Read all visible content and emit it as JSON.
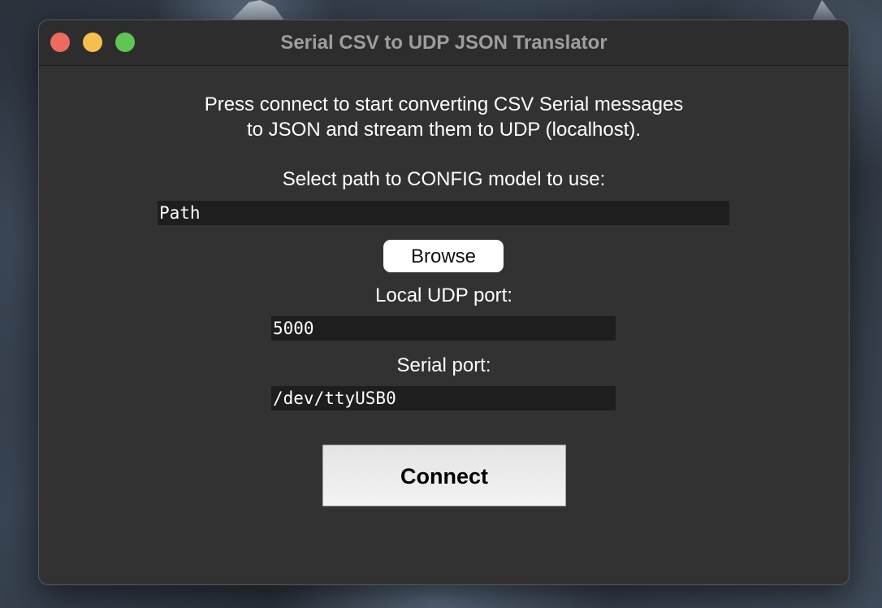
{
  "window": {
    "title": "Serial CSV to UDP JSON Translator"
  },
  "intro": {
    "line1": "Press connect to start converting CSV Serial messages",
    "line2": "to JSON and stream them to UDP (localhost)."
  },
  "config": {
    "label": "Select path to CONFIG model to use:",
    "value": "Path",
    "browse_label": "Browse"
  },
  "udp": {
    "label": "Local UDP port:",
    "value": "5000"
  },
  "serial": {
    "label": "Serial port:",
    "value": "/dev/ttyUSB0"
  },
  "connect_label": "Connect",
  "colors": {
    "close": "#ed6a5e",
    "minimize": "#f5bf4f",
    "zoom": "#61c554",
    "window_bg": "#323232",
    "field_bg": "#1e1e1e"
  }
}
